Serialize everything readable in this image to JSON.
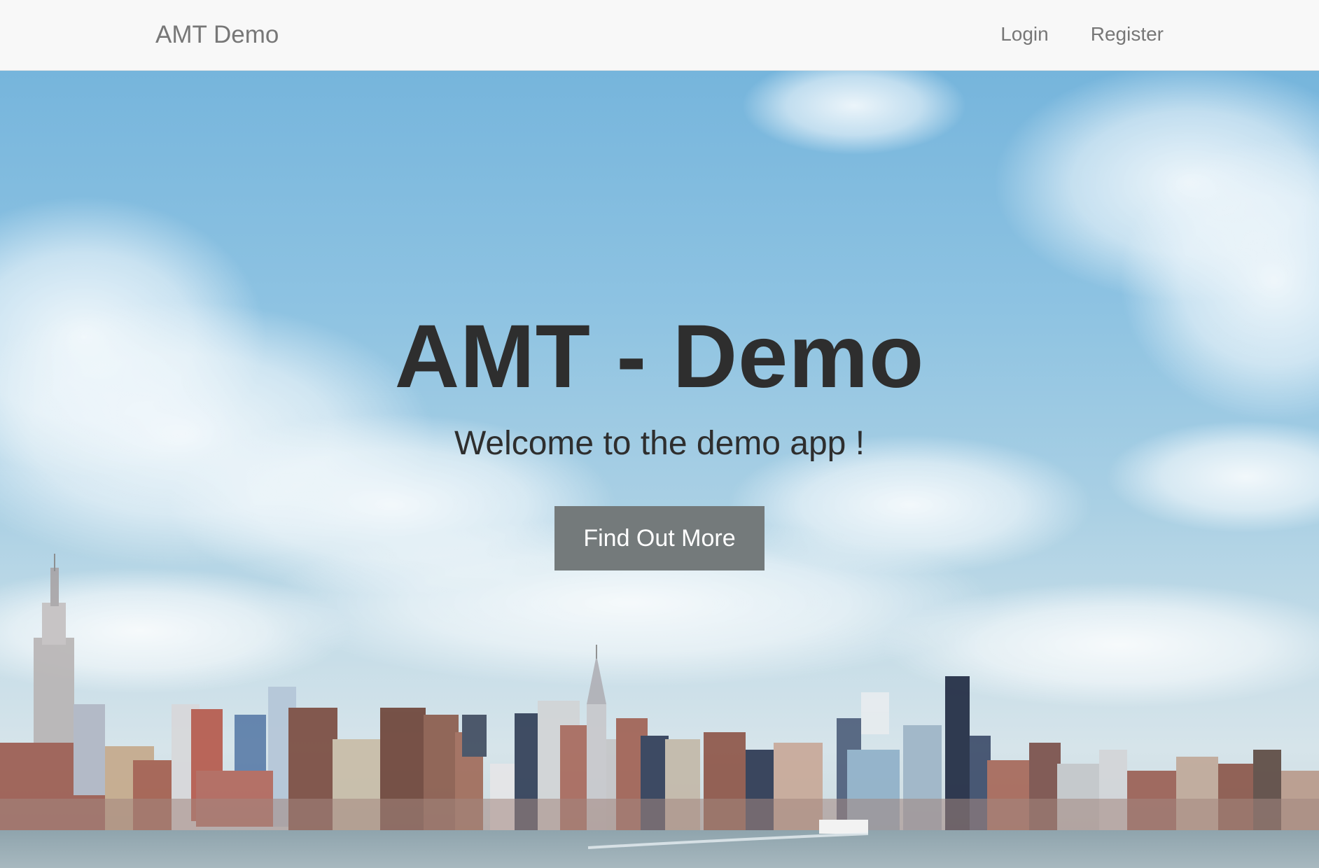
{
  "navbar": {
    "brand": "AMT Demo",
    "links": [
      {
        "label": "Login"
      },
      {
        "label": "Register"
      }
    ]
  },
  "hero": {
    "title": "AMT - Demo",
    "subtitle": "Welcome to the demo app !",
    "cta_label": "Find Out More",
    "background": "city-skyline-photo"
  },
  "colors": {
    "navbar_bg": "#f8f8f8",
    "nav_text": "#777777",
    "hero_text": "#2e2e2e",
    "cta_bg": "#747a7b",
    "cta_text": "#ffffff",
    "sky": "#76b5dc"
  }
}
